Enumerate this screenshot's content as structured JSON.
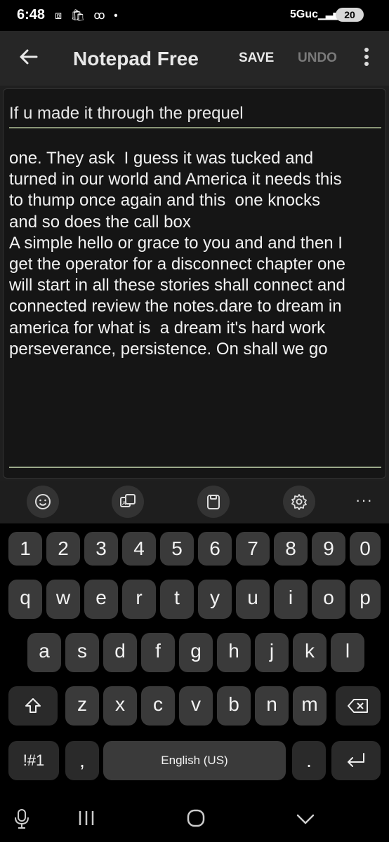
{
  "status_bar": {
    "time": "6:48",
    "network": "5Guc",
    "battery": "20"
  },
  "app_bar": {
    "title": "Notepad Free",
    "save_label": "SAVE",
    "undo_label": "UNDO"
  },
  "editor": {
    "note_title": "If u made it through the prequel",
    "body": "one. They ask  I guess it was tucked and\nturned in our world and America it needs this\nto thump once again and this  one knocks\nand so does the call box\nA simple hello or grace to you and and then I\nget the operator for a disconnect chapter one\nwill start in all these stories shall connect and\nconnected review the notes.dare to dream in\namerica for what is  a dream it's hard work\nperseverance, persistence. On shall we go"
  },
  "keyboard": {
    "toolbar": [
      "emoji-icon",
      "translate-icon",
      "clipboard-icon",
      "settings-icon",
      "more-icon"
    ],
    "more_label": "···",
    "num_row": [
      "1",
      "2",
      "3",
      "4",
      "5",
      "6",
      "7",
      "8",
      "9",
      "0"
    ],
    "row1": [
      "q",
      "w",
      "e",
      "r",
      "t",
      "y",
      "u",
      "i",
      "o",
      "p"
    ],
    "row2": [
      "a",
      "s",
      "d",
      "f",
      "g",
      "h",
      "j",
      "k",
      "l"
    ],
    "row3": [
      "z",
      "x",
      "c",
      "v",
      "b",
      "n",
      "m"
    ],
    "symbols_label": "!#1",
    "comma_label": ",",
    "space_label": "English (US)",
    "period_label": "."
  }
}
